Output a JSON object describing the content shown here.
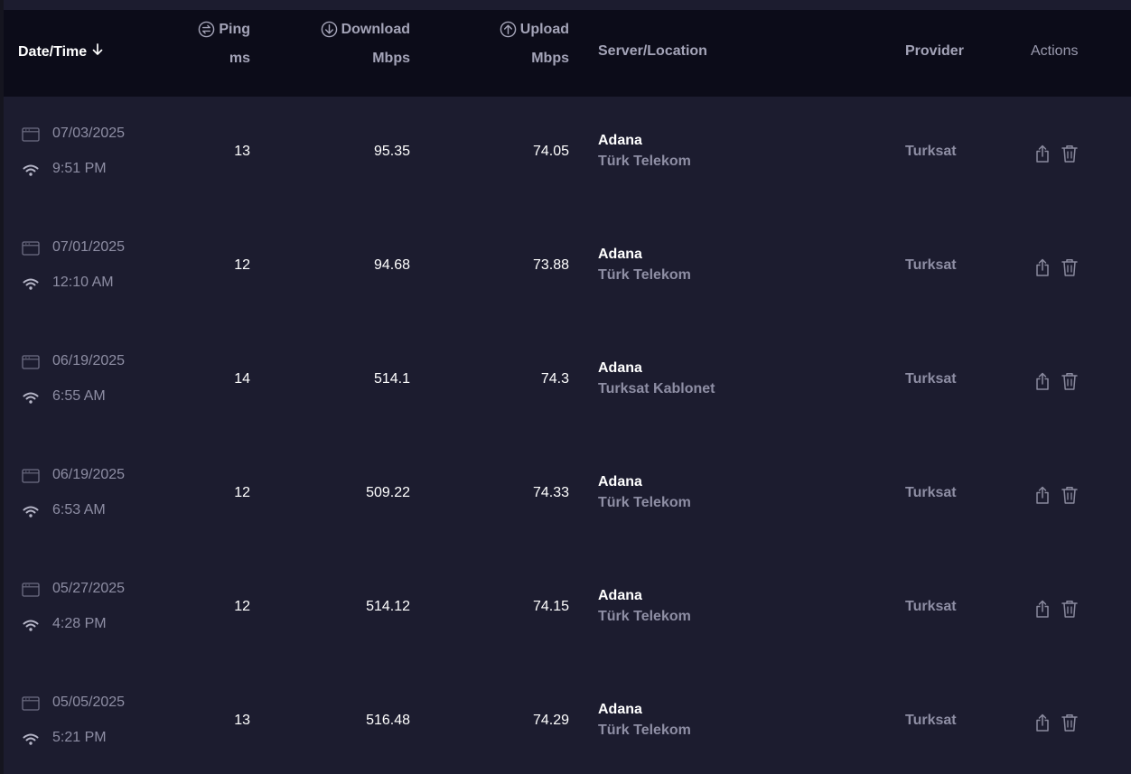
{
  "header": {
    "date_label": "Date/Time",
    "sort_icon": "arrow-down-icon",
    "ping_label": "Ping",
    "ping_unit": "ms",
    "ping_icon": "ping-icon",
    "download_label": "Download",
    "download_unit": "Mbps",
    "download_icon": "download-circle-icon",
    "upload_label": "Upload",
    "upload_unit": "Mbps",
    "upload_icon": "upload-circle-icon",
    "server_label": "Server/Location",
    "provider_label": "Provider",
    "actions_label": "Actions"
  },
  "rows": [
    {
      "date": "07/03/2025",
      "time": "9:51 PM",
      "ping": "13",
      "download": "95.35",
      "upload": "74.05",
      "city": "Adana",
      "isp": "Türk Telekom",
      "provider": "Turksat"
    },
    {
      "date": "07/01/2025",
      "time": "12:10 AM",
      "ping": "12",
      "download": "94.68",
      "upload": "73.88",
      "city": "Adana",
      "isp": "Türk Telekom",
      "provider": "Turksat"
    },
    {
      "date": "06/19/2025",
      "time": "6:55 AM",
      "ping": "14",
      "download": "514.1",
      "upload": "74.3",
      "city": "Adana",
      "isp": "Turksat Kablonet",
      "provider": "Turksat"
    },
    {
      "date": "06/19/2025",
      "time": "6:53 AM",
      "ping": "12",
      "download": "509.22",
      "upload": "74.33",
      "city": "Adana",
      "isp": "Türk Telekom",
      "provider": "Turksat"
    },
    {
      "date": "05/27/2025",
      "time": "4:28 PM",
      "ping": "12",
      "download": "514.12",
      "upload": "74.15",
      "city": "Adana",
      "isp": "Türk Telekom",
      "provider": "Turksat"
    },
    {
      "date": "05/05/2025",
      "time": "5:21 PM",
      "ping": "13",
      "download": "516.48",
      "upload": "74.29",
      "city": "Adana",
      "isp": "Türk Telekom",
      "provider": "Turksat"
    }
  ],
  "row_icons": {
    "date": "calendar-icon",
    "connection": "wifi-icon",
    "share": "share-icon",
    "delete": "trash-icon"
  },
  "colors": {
    "background": "#1c1c2f",
    "header_background": "#0c0c19",
    "primary_text": "#ffffff",
    "secondary_text": "#8e8ea4"
  }
}
